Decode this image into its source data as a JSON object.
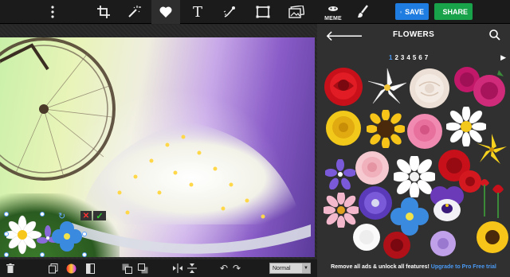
{
  "toolbar": {
    "save_label": "SAVE",
    "share_label": "SHARE",
    "meme_label": "MEME",
    "text_tool_label": "T"
  },
  "panel": {
    "title": "FLOWERS",
    "pages": [
      "1",
      "2",
      "3",
      "4",
      "5",
      "6",
      "7"
    ],
    "active_page": "1",
    "promo_text": "Remove all ads & unlock all features!",
    "promo_link": "Upgrade to Pro",
    "promo_tail": "Free trial"
  },
  "bottom": {
    "blend_mode": "Normal"
  },
  "colors": {
    "accent": "#1f7ce0",
    "share": "#18a34a",
    "panel_bg": "#303030",
    "page_active": "#4a9af5"
  }
}
